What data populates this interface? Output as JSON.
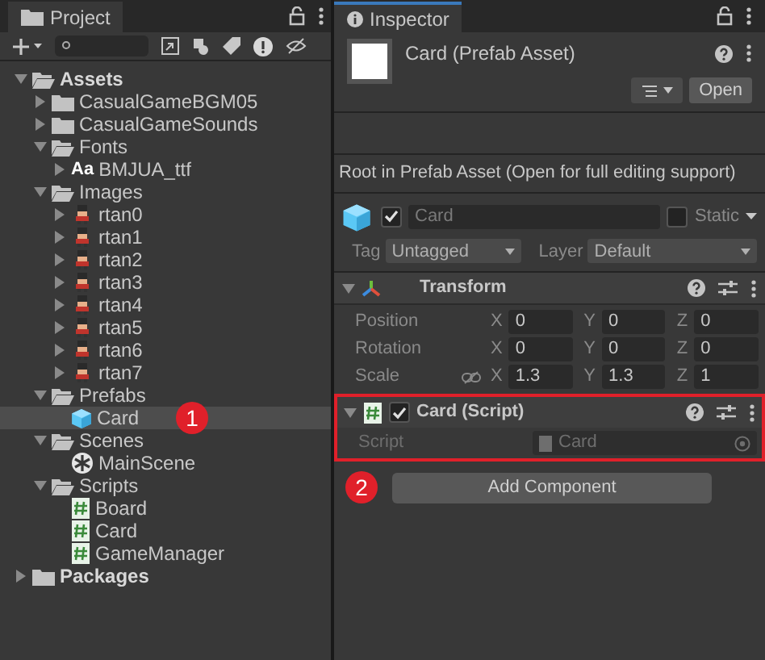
{
  "project": {
    "tab": "Project",
    "tree": [
      {
        "label": "Assets",
        "kind": "folder",
        "bold": true,
        "expanded": true,
        "selected": false,
        "children": [
          {
            "label": "CasualGameBGM05",
            "kind": "folder",
            "expanded": false,
            "selected": false
          },
          {
            "label": "CasualGameSounds",
            "kind": "folder",
            "expanded": false,
            "selected": false
          },
          {
            "label": "Fonts",
            "kind": "folder",
            "expanded": true,
            "selected": false,
            "children": [
              {
                "label": "BMJUA_ttf",
                "kind": "font",
                "glyph": "Aa",
                "expanded": false,
                "selected": false
              }
            ]
          },
          {
            "label": "Images",
            "kind": "folder",
            "expanded": true,
            "selected": false,
            "children": [
              {
                "label": "rtan0",
                "kind": "sprite",
                "expanded": false,
                "selected": false
              },
              {
                "label": "rtan1",
                "kind": "sprite",
                "expanded": false,
                "selected": false
              },
              {
                "label": "rtan2",
                "kind": "sprite",
                "expanded": false,
                "selected": false
              },
              {
                "label": "rtan3",
                "kind": "sprite",
                "expanded": false,
                "selected": false
              },
              {
                "label": "rtan4",
                "kind": "sprite",
                "expanded": false,
                "selected": false
              },
              {
                "label": "rtan5",
                "kind": "sprite",
                "expanded": false,
                "selected": false
              },
              {
                "label": "rtan6",
                "kind": "sprite",
                "expanded": false,
                "selected": false
              },
              {
                "label": "rtan7",
                "kind": "sprite",
                "expanded": false,
                "selected": false
              }
            ]
          },
          {
            "label": "Prefabs",
            "kind": "folder",
            "expanded": true,
            "selected": false,
            "children": [
              {
                "label": "Card",
                "kind": "prefab",
                "selected": true,
                "callout": "1"
              }
            ]
          },
          {
            "label": "Scenes",
            "kind": "folder",
            "expanded": true,
            "selected": false,
            "children": [
              {
                "label": "MainScene",
                "kind": "scene",
                "selected": false
              }
            ]
          },
          {
            "label": "Scripts",
            "kind": "folder",
            "expanded": true,
            "selected": false,
            "children": [
              {
                "label": "Board",
                "kind": "script",
                "selected": false
              },
              {
                "label": "Card",
                "kind": "script",
                "selected": false
              },
              {
                "label": "GameManager",
                "kind": "script",
                "selected": false
              }
            ]
          }
        ]
      },
      {
        "label": "Packages",
        "kind": "folder",
        "bold": true,
        "expanded": false,
        "selected": false
      }
    ]
  },
  "inspector": {
    "tab": "Inspector",
    "title": "Card (Prefab Asset)",
    "open_button": "Open",
    "note": "Root in Prefab Asset (Open for full editing support)",
    "object": {
      "active": true,
      "name": "Card",
      "static_label": "Static",
      "static": false,
      "tag_label": "Tag",
      "tag": "Untagged",
      "layer_label": "Layer",
      "layer": "Default"
    },
    "transform": {
      "title": "Transform",
      "expanded": true,
      "rows": [
        {
          "label": "Position",
          "link": false,
          "values": [
            {
              "axis": "X",
              "value": "0"
            },
            {
              "axis": "Y",
              "value": "0"
            },
            {
              "axis": "Z",
              "value": "0"
            }
          ]
        },
        {
          "label": "Rotation",
          "link": false,
          "values": [
            {
              "axis": "X",
              "value": "0"
            },
            {
              "axis": "Y",
              "value": "0"
            },
            {
              "axis": "Z",
              "value": "0"
            }
          ]
        },
        {
          "label": "Scale",
          "link": true,
          "values": [
            {
              "axis": "X",
              "value": "1.3"
            },
            {
              "axis": "Y",
              "value": "1.3"
            },
            {
              "axis": "Z",
              "value": "1"
            }
          ]
        }
      ]
    },
    "script_component": {
      "title": "Card (Script)",
      "enabled": true,
      "expanded": true,
      "highlighted": true,
      "field_label": "Script",
      "field_value": "Card"
    },
    "add_component": {
      "label": "Add Component",
      "callout": "2"
    }
  }
}
